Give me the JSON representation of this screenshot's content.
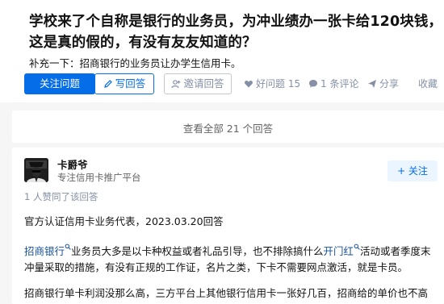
{
  "question": {
    "title": "学校来了个自称是银行的业务员，为冲业绩办一张卡给120块钱，这是真的假的，有没有友友知道的？",
    "detail": "补充一下：招商银行的业务员让办学生信用卡。"
  },
  "actions": {
    "follow_question": "关注问题",
    "write_answer": "写回答",
    "invite_answer": "邀请回答",
    "good_question": "好问题 15",
    "comments": "1 条评论",
    "share": "分享",
    "collect": "收藏"
  },
  "view_all": "查看全部 21 个回答",
  "answer": {
    "author_name": "卡爵爷",
    "author_bio": "专注信用卡推广平台",
    "follow_label": "+ 关注",
    "upvote_info": "1 人赞同了该回答",
    "para1": "官方认证信用卡业务代表，2023.03.20回答",
    "para2_link1": "招商银行",
    "para2_text1": "业务员大多是以卡种权益或者礼品引导，也不排除搞什么",
    "para2_link2": "开门红",
    "para2_text2": "活动或者季度末冲量采取的措施，有没有正规的工作证，名片之类，下卡不需要网点激活，就是卡员。",
    "para3": "招商银行单卡利润没那么高，三方平台上其他银行信用卡一张好几百，招商给的单价也不高"
  },
  "colors": {
    "brand_blue": "#056de8",
    "link_blue": "#175199",
    "muted_gray": "#8590a6",
    "page_bg": "#f6f6f6"
  },
  "icons": [
    "pencil-icon",
    "invite-icon",
    "heart-icon",
    "comment-icon",
    "share-icon",
    "link-marker-icon"
  ]
}
